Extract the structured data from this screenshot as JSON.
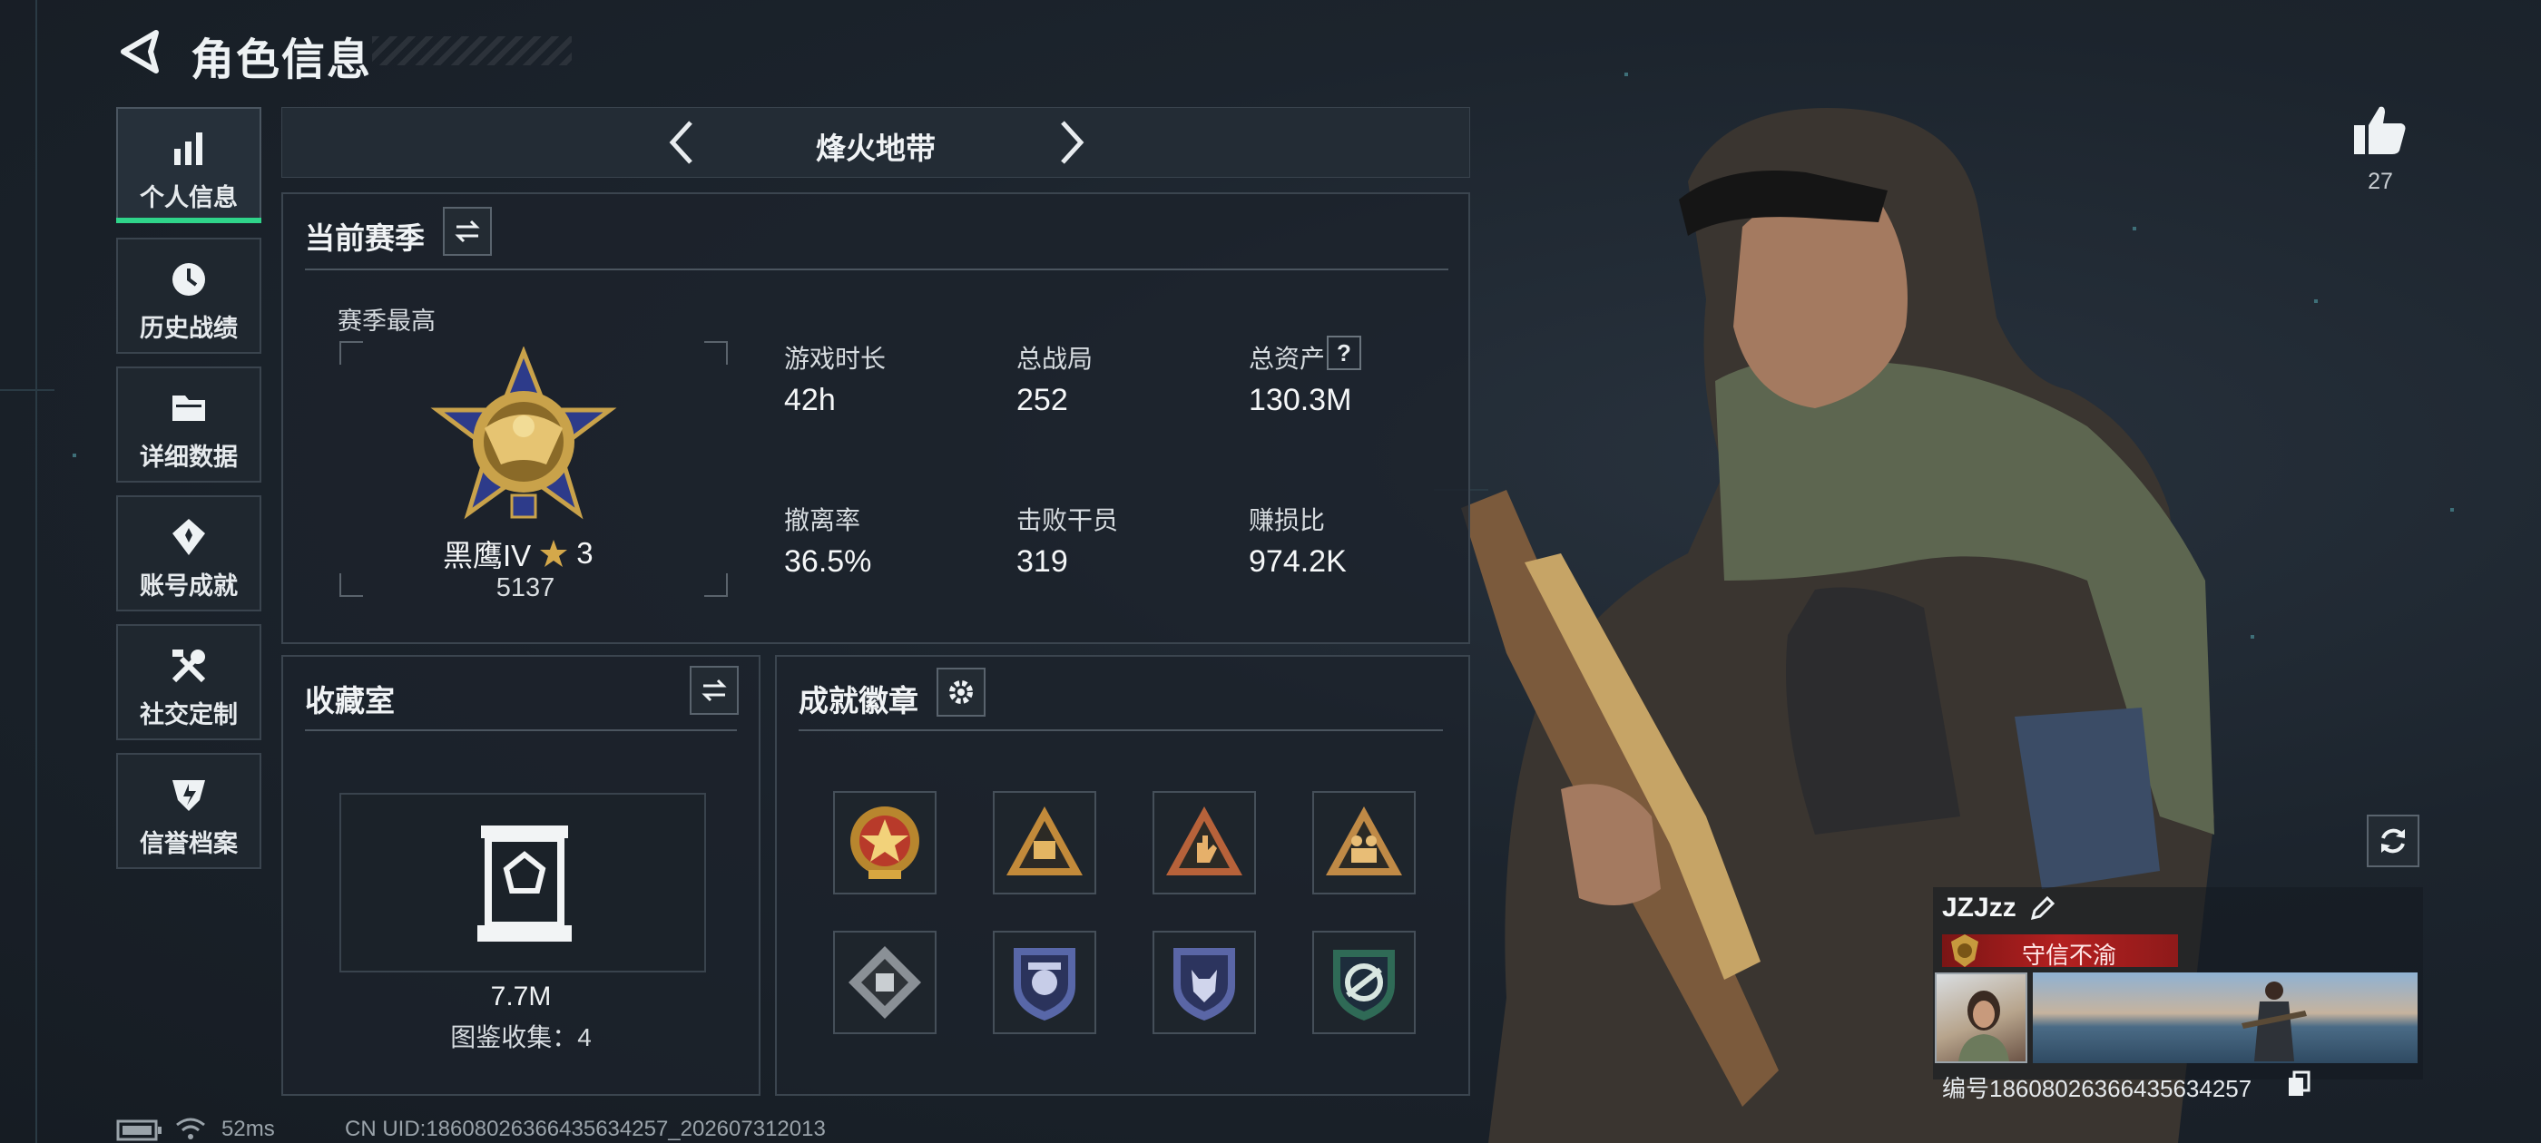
{
  "header": {
    "title": "角色信息"
  },
  "sidebar": {
    "items": [
      {
        "label": "个人信息",
        "icon": "bar-chart-icon"
      },
      {
        "label": "历史战绩",
        "icon": "clock-icon"
      },
      {
        "label": "详细数据",
        "icon": "folder-icon"
      },
      {
        "label": "账号成就",
        "icon": "achievement-icon"
      },
      {
        "label": "社交定制",
        "icon": "tools-icon"
      },
      {
        "label": "信誉档案",
        "icon": "shield-icon"
      }
    ]
  },
  "mode": {
    "name": "烽火地带"
  },
  "season": {
    "title": "当前赛季",
    "best_label": "赛季最高",
    "rank_name": "黑鹰IV",
    "rank_stars": "3",
    "rank_points": "5137",
    "stats": [
      {
        "label": "游戏时长",
        "value": "42h"
      },
      {
        "label": "总战局",
        "value": "252"
      },
      {
        "label": "总资产",
        "value": "130.3M"
      },
      {
        "label": "撤离率",
        "value": "36.5%"
      },
      {
        "label": "击败干员",
        "value": "319"
      },
      {
        "label": "赚损比",
        "value": "974.2K"
      }
    ],
    "help_glyph": "?"
  },
  "collection": {
    "title": "收藏室",
    "value": "7.7M",
    "catalog_label": "图鉴收集：4"
  },
  "achievements": {
    "title": "成就徽章",
    "badges": [
      "star-medal-icon",
      "triangle-58-icon",
      "triangle-hand-icon",
      "triangle-figures-icon",
      "diamond-badge-icon",
      "police-shield-icon",
      "wolf-shield-icon",
      "circle-arrow-shield-icon"
    ]
  },
  "social": {
    "like_count": "27"
  },
  "player_card": {
    "name": "JZJzz",
    "title": "守信不渝",
    "id_text": "编号18608026366435634257"
  },
  "status_bar": {
    "ping": "52ms",
    "uid": "CN UID:18608026366435634257_202607312013"
  },
  "colors": {
    "accent": "#2fd48a",
    "title_red": "#b42020",
    "gold": "#d4a84a"
  }
}
